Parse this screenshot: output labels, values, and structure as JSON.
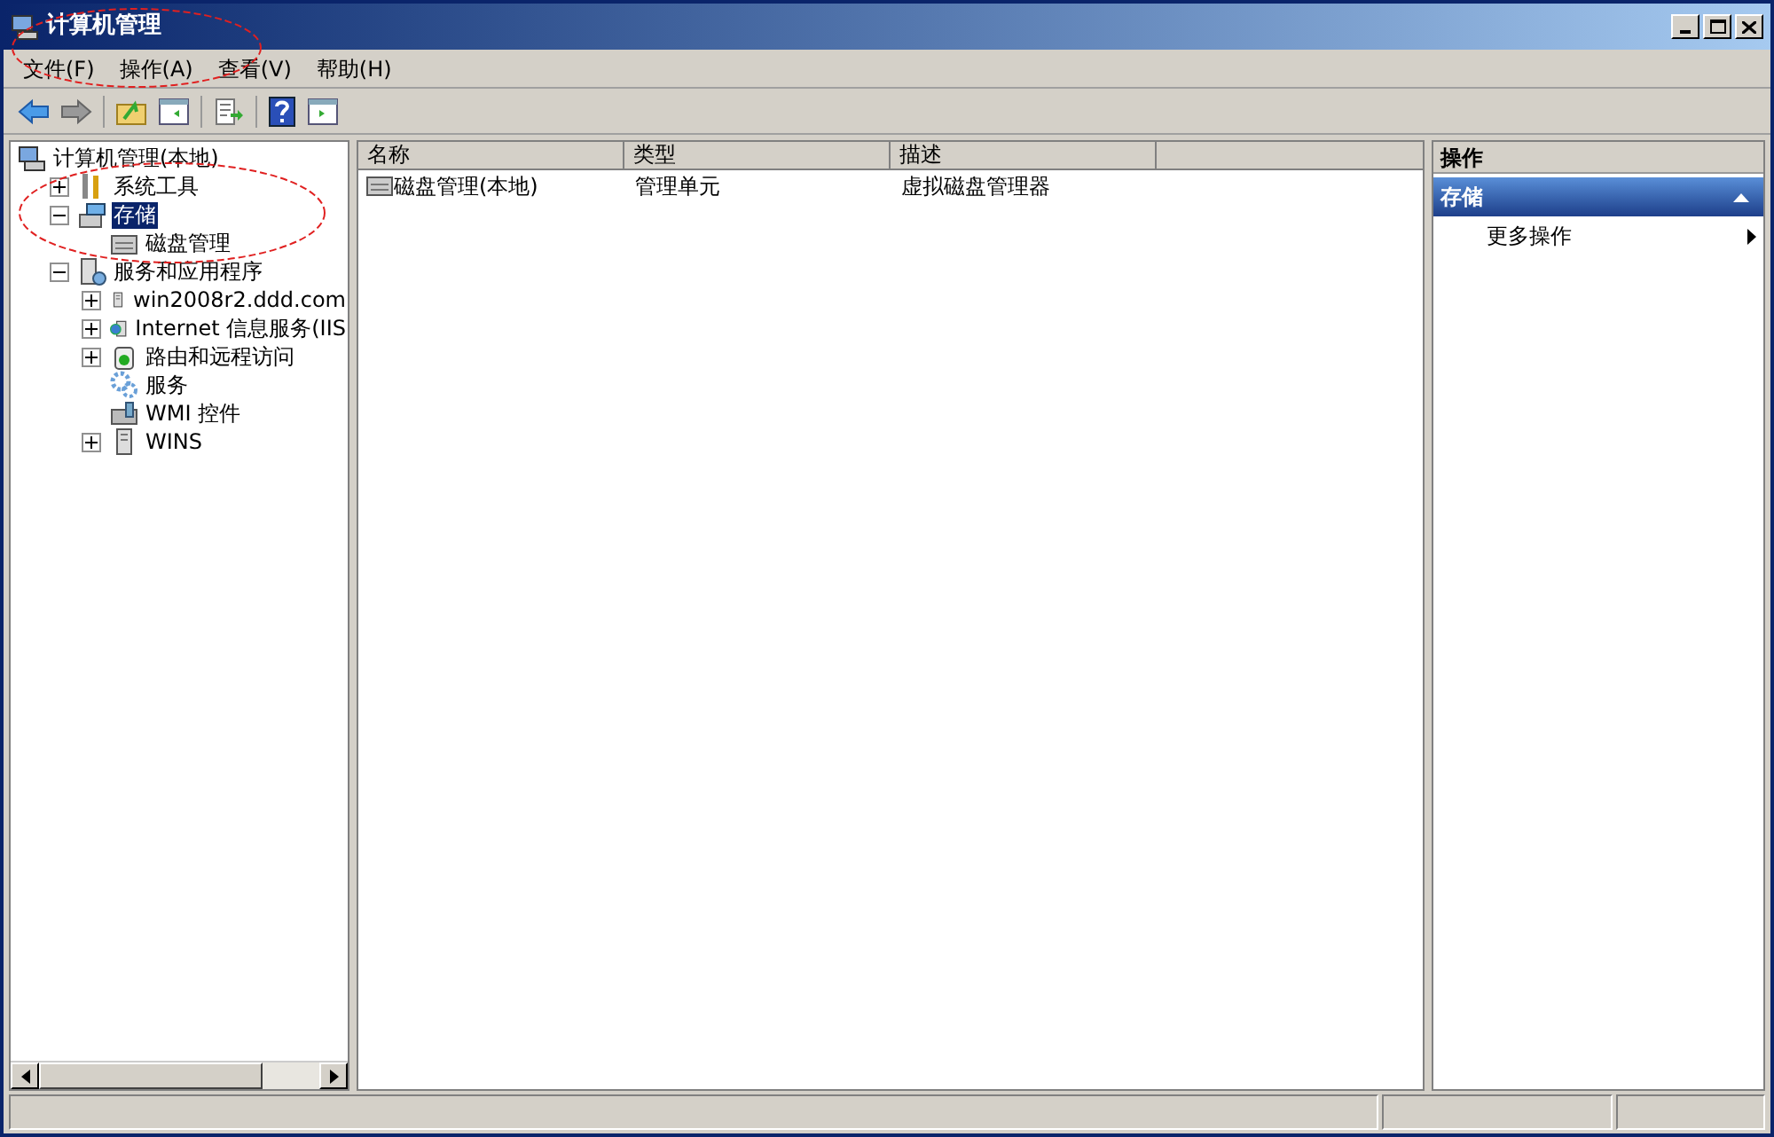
{
  "window": {
    "title": "计算机管理"
  },
  "menu": [
    "文件(F)",
    "操作(A)",
    "查看(V)",
    "帮助(H)"
  ],
  "tree": [
    {
      "label": "计算机管理(本地)",
      "kind": "root",
      "selected": false,
      "children": [
        {
          "label": "系统工具",
          "kind": "branch",
          "expanded": false,
          "selected": false
        },
        {
          "label": "存储",
          "kind": "branch",
          "expanded": true,
          "selected": true,
          "children": [
            {
              "label": "磁盘管理",
              "kind": "leaf",
              "selected": false
            }
          ]
        },
        {
          "label": "服务和应用程序",
          "kind": "branch",
          "expanded": true,
          "selected": false,
          "children": [
            {
              "label": "win2008r2.ddd.com",
              "kind": "branch",
              "expanded": false,
              "selected": false
            },
            {
              "label": "Internet 信息服务(IIS",
              "kind": "branch",
              "expanded": false,
              "selected": false
            },
            {
              "label": "路由和远程访问",
              "kind": "branch",
              "expanded": false,
              "selected": false
            },
            {
              "label": "服务",
              "kind": "leaf",
              "selected": false
            },
            {
              "label": "WMI 控件",
              "kind": "leaf",
              "selected": false
            },
            {
              "label": "WINS",
              "kind": "branch",
              "expanded": false,
              "selected": false
            }
          ]
        }
      ]
    }
  ],
  "table": {
    "columns": [
      "名称",
      "类型",
      "描述"
    ],
    "rows": [
      {
        "cells": [
          "磁盘管理(本地)",
          "管理单元",
          "虚拟磁盘管理器"
        ]
      }
    ]
  },
  "actions": {
    "title": "操作",
    "section": "存储",
    "items": [
      "更多操作"
    ]
  }
}
